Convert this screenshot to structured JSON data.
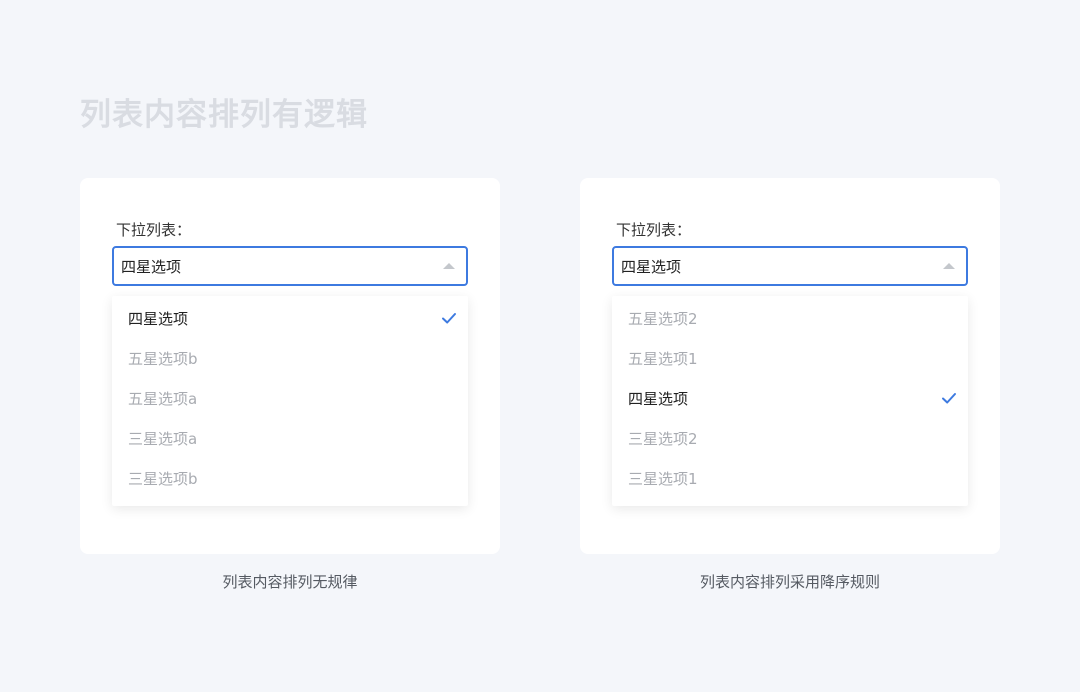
{
  "page": {
    "title": "列表内容排列有逻辑"
  },
  "accent_color": "#3d7ae0",
  "examples": [
    {
      "label": "下拉列表：",
      "selected_value": "四星选项",
      "options": [
        {
          "text": "四星选项",
          "selected": true
        },
        {
          "text": "五星选项b",
          "selected": false
        },
        {
          "text": "五星选项a",
          "selected": false
        },
        {
          "text": "三星选项a",
          "selected": false
        },
        {
          "text": "三星选项b",
          "selected": false
        }
      ],
      "caption": "列表内容排列无规律"
    },
    {
      "label": "下拉列表：",
      "selected_value": "四星选项",
      "options": [
        {
          "text": "五星选项2",
          "selected": false
        },
        {
          "text": "五星选项1",
          "selected": false
        },
        {
          "text": "四星选项",
          "selected": true
        },
        {
          "text": "三星选项2",
          "selected": false
        },
        {
          "text": "三星选项1",
          "selected": false
        }
      ],
      "caption": "列表内容排列采用降序规则"
    }
  ]
}
